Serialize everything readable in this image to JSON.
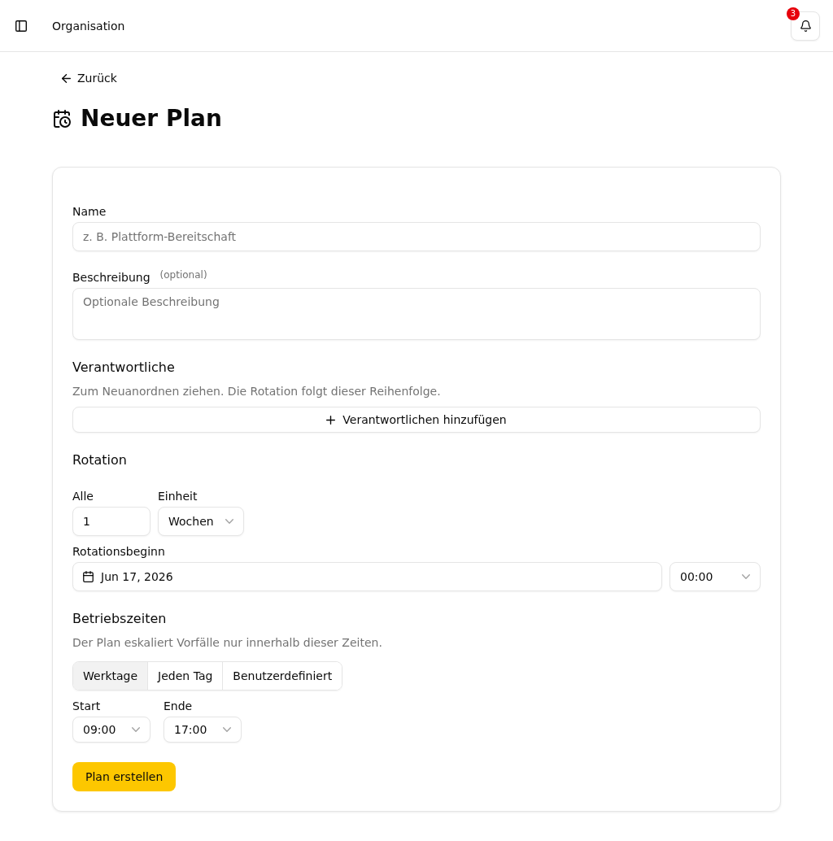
{
  "header": {
    "org_name": "Organisation",
    "notifications": {
      "count": "3"
    }
  },
  "back_link": "Zurück",
  "page_title": "Neuer Plan",
  "form": {
    "name_field": {
      "label": "Name",
      "placeholder": "z. B. Plattform-Bereitschaft"
    },
    "description_field": {
      "label": "Beschreibung",
      "optional_note": "(optional)",
      "placeholder": "Optionale Beschreibung"
    },
    "owners": {
      "heading": "Verantwortliche",
      "help": "Zum Neuanordnen ziehen. Die Rotation folgt dieser Reihenfolge.",
      "add_button": "Verantwortlichen hinzufügen"
    },
    "rotation": {
      "heading": "Rotation",
      "interval": {
        "label": "Alle",
        "value": "1"
      },
      "unit": {
        "label": "Einheit",
        "value": "Wochen"
      },
      "start": {
        "label": "Rotationsbeginn",
        "date": "Jun 17, 2026",
        "time": "00:00"
      }
    },
    "hours": {
      "heading": "Betriebszeiten",
      "help": "Der Plan eskaliert Vorfälle nur innerhalb dieser Zeiten.",
      "options": [
        {
          "label": "Werktage",
          "selected": true
        },
        {
          "label": "Jeden Tag",
          "selected": false
        },
        {
          "label": "Benutzerdefiniert",
          "selected": false
        }
      ],
      "start": {
        "label": "Start",
        "value": "09:00"
      },
      "end": {
        "label": "Ende",
        "value": "17:00"
      }
    },
    "submit_button": "Plan erstellen"
  }
}
